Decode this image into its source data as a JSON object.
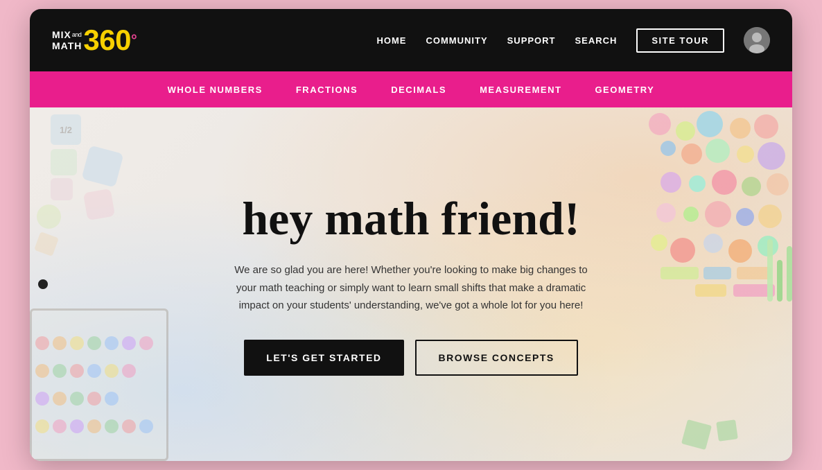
{
  "site": {
    "title": "MIX and MATH 360°"
  },
  "navbar": {
    "logo": {
      "mix": "MIX",
      "and": "and",
      "math": "MATH",
      "num": "360",
      "degree": "°"
    },
    "links": [
      {
        "label": "HOME",
        "id": "home"
      },
      {
        "label": "COMMUNITY",
        "id": "community"
      },
      {
        "label": "SUPPORT",
        "id": "support"
      },
      {
        "label": "SEARCH",
        "id": "search"
      },
      {
        "label": "SITE TOUR",
        "id": "site-tour"
      }
    ]
  },
  "secondary_nav": {
    "links": [
      {
        "label": "WHOLE NUMBERS",
        "id": "whole-numbers"
      },
      {
        "label": "FRACTIONS",
        "id": "fractions"
      },
      {
        "label": "DECIMALS",
        "id": "decimals"
      },
      {
        "label": "MEASUREMENT",
        "id": "measurement"
      },
      {
        "label": "GEOMETRY",
        "id": "geometry"
      }
    ]
  },
  "hero": {
    "title": "hey math friend!",
    "subtitle": "We are so glad you are here! Whether you're looking to make big changes to your math teaching or simply want to learn small shifts that make a dramatic impact on your students' understanding, we've got a whole lot for you here!",
    "btn_primary": "LET'S GET STARTED",
    "btn_secondary": "BROWSE CONCEPTS"
  },
  "colors": {
    "navbar_bg": "#111111",
    "secondary_nav_bg": "#e91e8c",
    "logo_num": "#f7d000",
    "logo_degree": "#e84393",
    "btn_primary_bg": "#111111",
    "hero_bg": "#ece8e4"
  }
}
